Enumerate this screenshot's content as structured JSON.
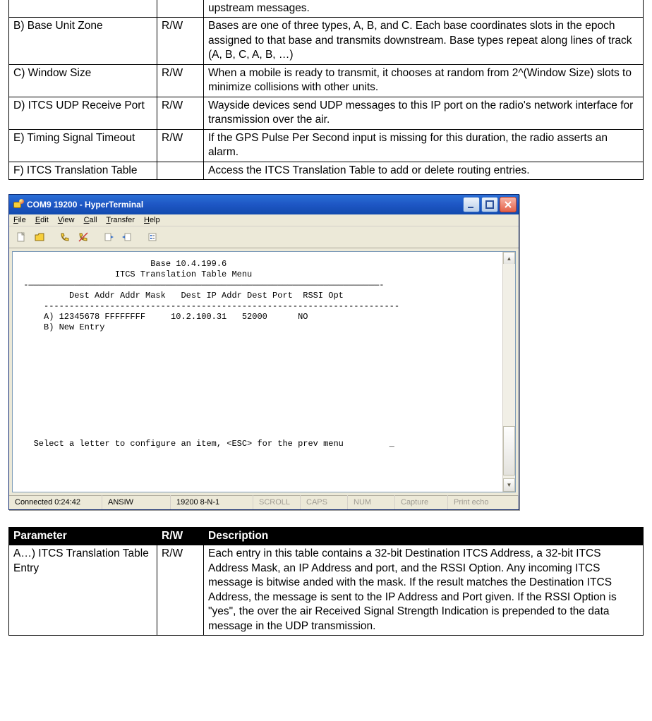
{
  "tables": {
    "upper": {
      "rows": [
        {
          "param": "",
          "rw": "",
          "desc": "upstream messages."
        },
        {
          "param": "B) Base Unit Zone",
          "rw": "R/W",
          "desc": "Bases are one of three types, A, B, and C.  Each base coordinates slots in the epoch assigned to that base and transmits downstream. Base types repeat along lines of track (A, B, C, A, B, …)"
        },
        {
          "param": "C) Window Size",
          "rw": "R/W",
          "desc": "When a mobile is ready to transmit, it chooses at random from 2^(Window Size) slots to minimize collisions with other units."
        },
        {
          "param": "D) ITCS UDP Receive Port",
          "rw": "R/W",
          "desc": "Wayside devices send UDP messages to this IP port on the radio's network interface for transmission over the air."
        },
        {
          "param": "E) Timing Signal Timeout",
          "rw": "R/W",
          "desc": "If the GPS Pulse Per Second input is missing for this duration, the radio asserts an alarm."
        },
        {
          "param": "F) ITCS Translation Table",
          "rw": "",
          "desc": "Access the ITCS Translation Table to add or delete routing entries."
        }
      ]
    },
    "lower": {
      "head": {
        "param": "Parameter",
        "rw": "R/W",
        "desc": "Description"
      },
      "rows": [
        {
          "param": "A…) ITCS Translation Table Entry",
          "rw": "R/W",
          "desc": "Each entry in this table contains a 32-bit Destination ITCS Address, a 32-bit ITCS Address Mask, an IP Address and port, and the RSSI Option.  Any incoming ITCS message is bitwise anded with the mask.  If the result matches the Destination ITCS Address, the message is sent to the IP Address and Port given.  If the RSSI Option is \"yes\", the over the air Received Signal Strength Indication is prepended to the data message in the UDP transmission."
        }
      ]
    }
  },
  "window": {
    "title": "COM9 19200 - HyperTerminal",
    "menu": {
      "file": "File",
      "edit": "Edit",
      "view": "View",
      "call": "Call",
      "transfer": "Transfer",
      "help": "Help"
    },
    "terminal_lines": [
      "                          Base 10.4.199.6",
      "                   ITCS Translation Table Menu",
      " -—————————————————————————————————————————————————————————————————————-",
      "          Dest Addr Addr Mask   Dest IP Addr Dest Port  RSSI Opt",
      "     ----------------------------------------------------------------------",
      "     A) 12345678 FFFFFFFF     10.2.100.31   52000      NO",
      "     B) New Entry",
      "",
      "",
      "",
      "",
      "",
      "",
      "",
      "",
      "",
      "",
      "   Select a letter to configure an item, <ESC> for the prev menu         _"
    ],
    "status": {
      "connected": "Connected 0:24:42",
      "emulation": "ANSIW",
      "port": "19200 8-N-1",
      "scroll": "SCROLL",
      "caps": "CAPS",
      "num": "NUM",
      "capture": "Capture",
      "printecho": "Print echo"
    }
  }
}
